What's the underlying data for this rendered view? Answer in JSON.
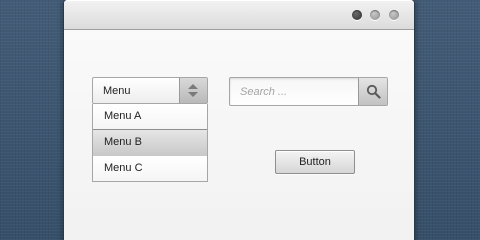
{
  "window": {
    "controls": [
      "dark-dot-icon",
      "grey-dot-icon",
      "grey-dot-icon"
    ]
  },
  "dropdown": {
    "selected_label": "Menu",
    "toggle_icon": "up-down-arrows-icon",
    "items": [
      {
        "label": "Menu A",
        "selected": false
      },
      {
        "label": "Menu B",
        "selected": true
      },
      {
        "label": "Menu C",
        "selected": false
      }
    ]
  },
  "search": {
    "placeholder": "Search ...",
    "value": "",
    "button_icon": "magnifier-icon"
  },
  "button": {
    "label": "Button"
  },
  "colors": {
    "background": "#3c5570",
    "window": "#f6f6f6",
    "selected_item": "#d2d2d2"
  }
}
